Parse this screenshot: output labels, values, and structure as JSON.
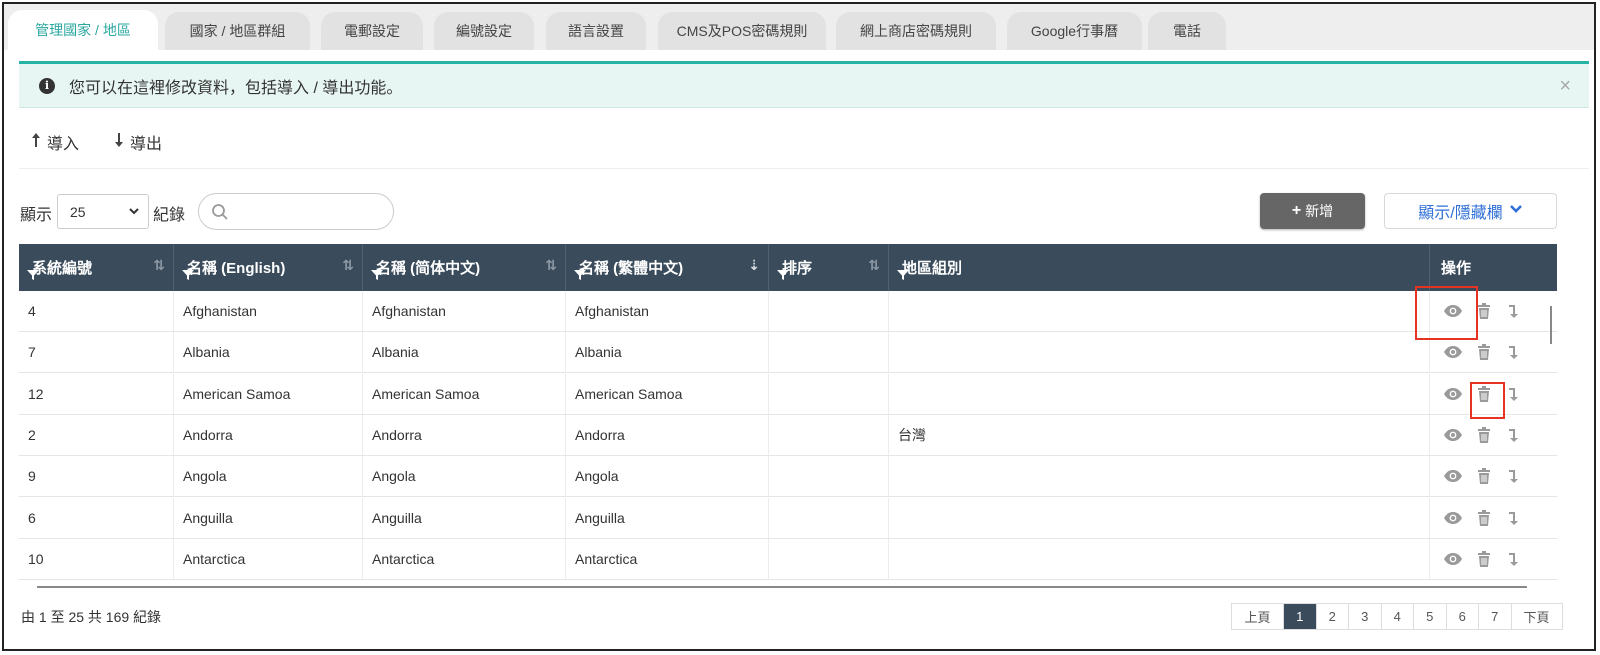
{
  "tabs": [
    {
      "label": "管理國家 / 地區",
      "active": true
    },
    {
      "label": "國家 / 地區群組",
      "active": false
    },
    {
      "label": "電郵設定",
      "active": false
    },
    {
      "label": "編號設定",
      "active": false
    },
    {
      "label": "語言設置",
      "active": false
    },
    {
      "label": "CMS及POS密碼規則",
      "active": false
    },
    {
      "label": "網上商店密碼規則",
      "active": false
    },
    {
      "label": "Google行事曆",
      "active": false
    },
    {
      "label": "電話",
      "active": false
    }
  ],
  "alert": {
    "message": "您可以在這裡修改資料，包括導入 / 導出功能。",
    "close": "×"
  },
  "toolbar": {
    "import_label": "導入",
    "export_label": "導出"
  },
  "length": {
    "prefix": "顯示",
    "value": "25",
    "suffix": "紀錄"
  },
  "search": {
    "placeholder": ""
  },
  "buttons": {
    "add_label": "新增",
    "toggle_columns_label": "顯示/隱藏欄"
  },
  "table": {
    "columns": [
      "系統編號",
      "名稱 (English)",
      "名稱 (简体中文)",
      "名稱 (繁體中文)",
      "排序",
      "地區組別",
      "操作"
    ],
    "rows": [
      {
        "id": "4",
        "en": "Afghanistan",
        "sc": "Afghanistan",
        "tc": "Afghanistan",
        "order": "",
        "group": ""
      },
      {
        "id": "7",
        "en": "Albania",
        "sc": "Albania",
        "tc": "Albania",
        "order": "",
        "group": ""
      },
      {
        "id": "12",
        "en": "American Samoa",
        "sc": "American Samoa",
        "tc": "American Samoa",
        "order": "",
        "group": ""
      },
      {
        "id": "2",
        "en": "Andorra",
        "sc": "Andorra",
        "tc": "Andorra",
        "order": "",
        "group": "台灣"
      },
      {
        "id": "9",
        "en": "Angola",
        "sc": "Angola",
        "tc": "Angola",
        "order": "",
        "group": ""
      },
      {
        "id": "6",
        "en": "Anguilla",
        "sc": "Anguilla",
        "tc": "Anguilla",
        "order": "",
        "group": ""
      },
      {
        "id": "10",
        "en": "Antarctica",
        "sc": "Antarctica",
        "tc": "Antarctica",
        "order": "",
        "group": ""
      }
    ]
  },
  "footer": {
    "info": "由 1 至 25 共 169 紀錄",
    "prev": "上頁",
    "pages": [
      "1",
      "2",
      "3",
      "4",
      "5",
      "6",
      "7"
    ],
    "current_page": "1",
    "next": "下頁"
  },
  "colors": {
    "accent": "#2aa7a0",
    "header_bg": "#3a4c5c",
    "highlight": "#e53323",
    "link": "#2f6fd6"
  }
}
